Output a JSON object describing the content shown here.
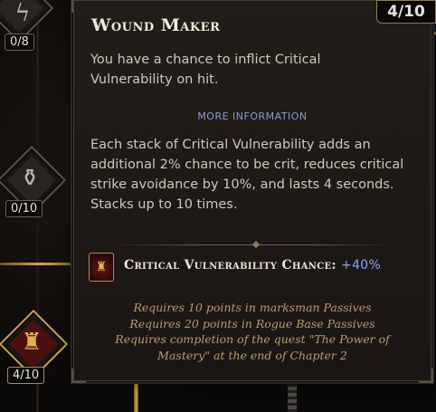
{
  "tree": {
    "nodes": [
      {
        "counter": "0/8",
        "icon": "lightning-icon"
      },
      {
        "counter": "0/10",
        "icon": "potion-icon"
      },
      {
        "counter": "4/10",
        "icon": "wound-maker-icon"
      }
    ],
    "right_counter": "4/10"
  },
  "tooltip": {
    "title": "Wound Maker",
    "description": "You have a chance to inflict Critical Vulnerability on hit.",
    "more_info_label": "MORE INFORMATION",
    "more_info_text": "Each stack of Critical Vulnerability adds an additional 2% chance to be crit, reduces critical strike avoidance by 10%, and lasts 4 seconds. Stacks up to 10 times.",
    "stat_label": "Critical Vulnerability Chance:",
    "stat_value": "+40%",
    "requirements": [
      "Requires 10 points in marksman Passives",
      "Requires 20 points in Rogue Base Passives",
      "Requires completion of the quest \"The Power of",
      "Mastery\" at the end of Chapter 2"
    ]
  },
  "colors": {
    "accent_blue": "#8ea3f0",
    "gold": "#d7a94c",
    "requirement_text": "#b89a72"
  }
}
